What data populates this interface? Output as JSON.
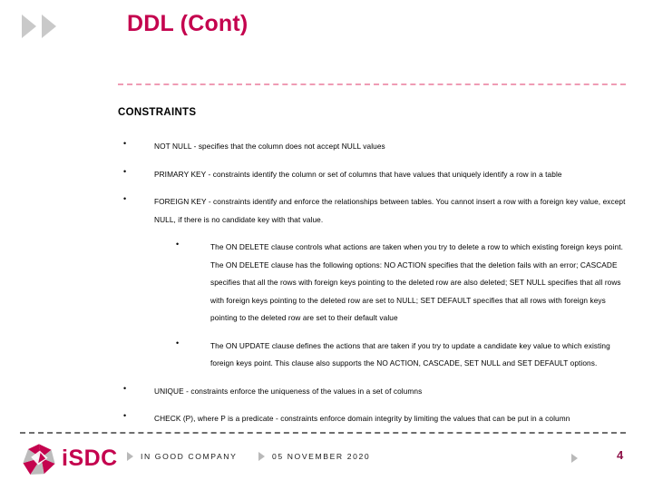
{
  "slide": {
    "title": "DDL (Cont)",
    "title_color": "#c4034e",
    "header_arrow_icons": [
      "triangle-right-icon",
      "triangle-right-icon"
    ],
    "divider_top_color": "#ef9bb4",
    "divider_bottom_color": "#6e6e6e"
  },
  "content": {
    "heading": "CONSTRAINTS",
    "blocks": [
      {
        "level": 1,
        "bullet": "•",
        "text": "NOT NULL - specifies that the column does not accept NULL values"
      },
      {
        "level": 1,
        "bullet": "•",
        "text": "PRIMARY KEY - constraints identify the column or set of columns that have values that uniquely identify a row in a table"
      },
      {
        "level": 1,
        "bullet": "•",
        "text": "FOREIGN KEY - constraints identify and enforce the relationships between tables. You cannot insert a row with a foreign key value, except NULL, if there is no candidate key with that value."
      },
      {
        "level": 2,
        "bullet": "•",
        "text": "The ON DELETE clause controls what actions are taken when you try to delete a row to which existing foreign keys point. The ON DELETE clause has the following options: NO ACTION specifies that the deletion fails with an error; CASCADE specifies that all the rows with foreign keys pointing to the deleted row are also deleted; SET NULL specifies that all rows with foreign keys pointing to the deleted row are set to NULL; SET DEFAULT specifies that all rows with foreign keys pointing to the deleted row are set to their default value"
      },
      {
        "level": 2,
        "bullet": "•",
        "text": "The ON UPDATE clause defines the actions that are taken if you try to update a candidate key value to which existing foreign keys point. This clause also supports the NO ACTION, CASCADE, SET NULL and SET DEFAULT options."
      },
      {
        "level": 1,
        "bullet": "•",
        "text": "UNIQUE - constraints enforce the uniqueness of the values in a set of columns"
      },
      {
        "level": 1,
        "bullet": "•",
        "text": "CHECK (P), where P is a predicate - constraints enforce domain integrity by limiting the values that can be put in a column"
      }
    ]
  },
  "footer": {
    "logo_icon": "isdc-pinwheel-logo-icon",
    "logo_text_lead": "i",
    "logo_text_rest": "SDC",
    "logo_color": "#c4034e",
    "items": [
      {
        "arrow_icon": "triangle-right-icon",
        "label": "IN GOOD COMPANY"
      },
      {
        "arrow_icon": "triangle-right-icon",
        "label": "05 NOVEMBER 2020"
      }
    ],
    "page_arrow_icon": "triangle-right-icon",
    "page_number": "4",
    "page_number_color": "#8e1148"
  }
}
